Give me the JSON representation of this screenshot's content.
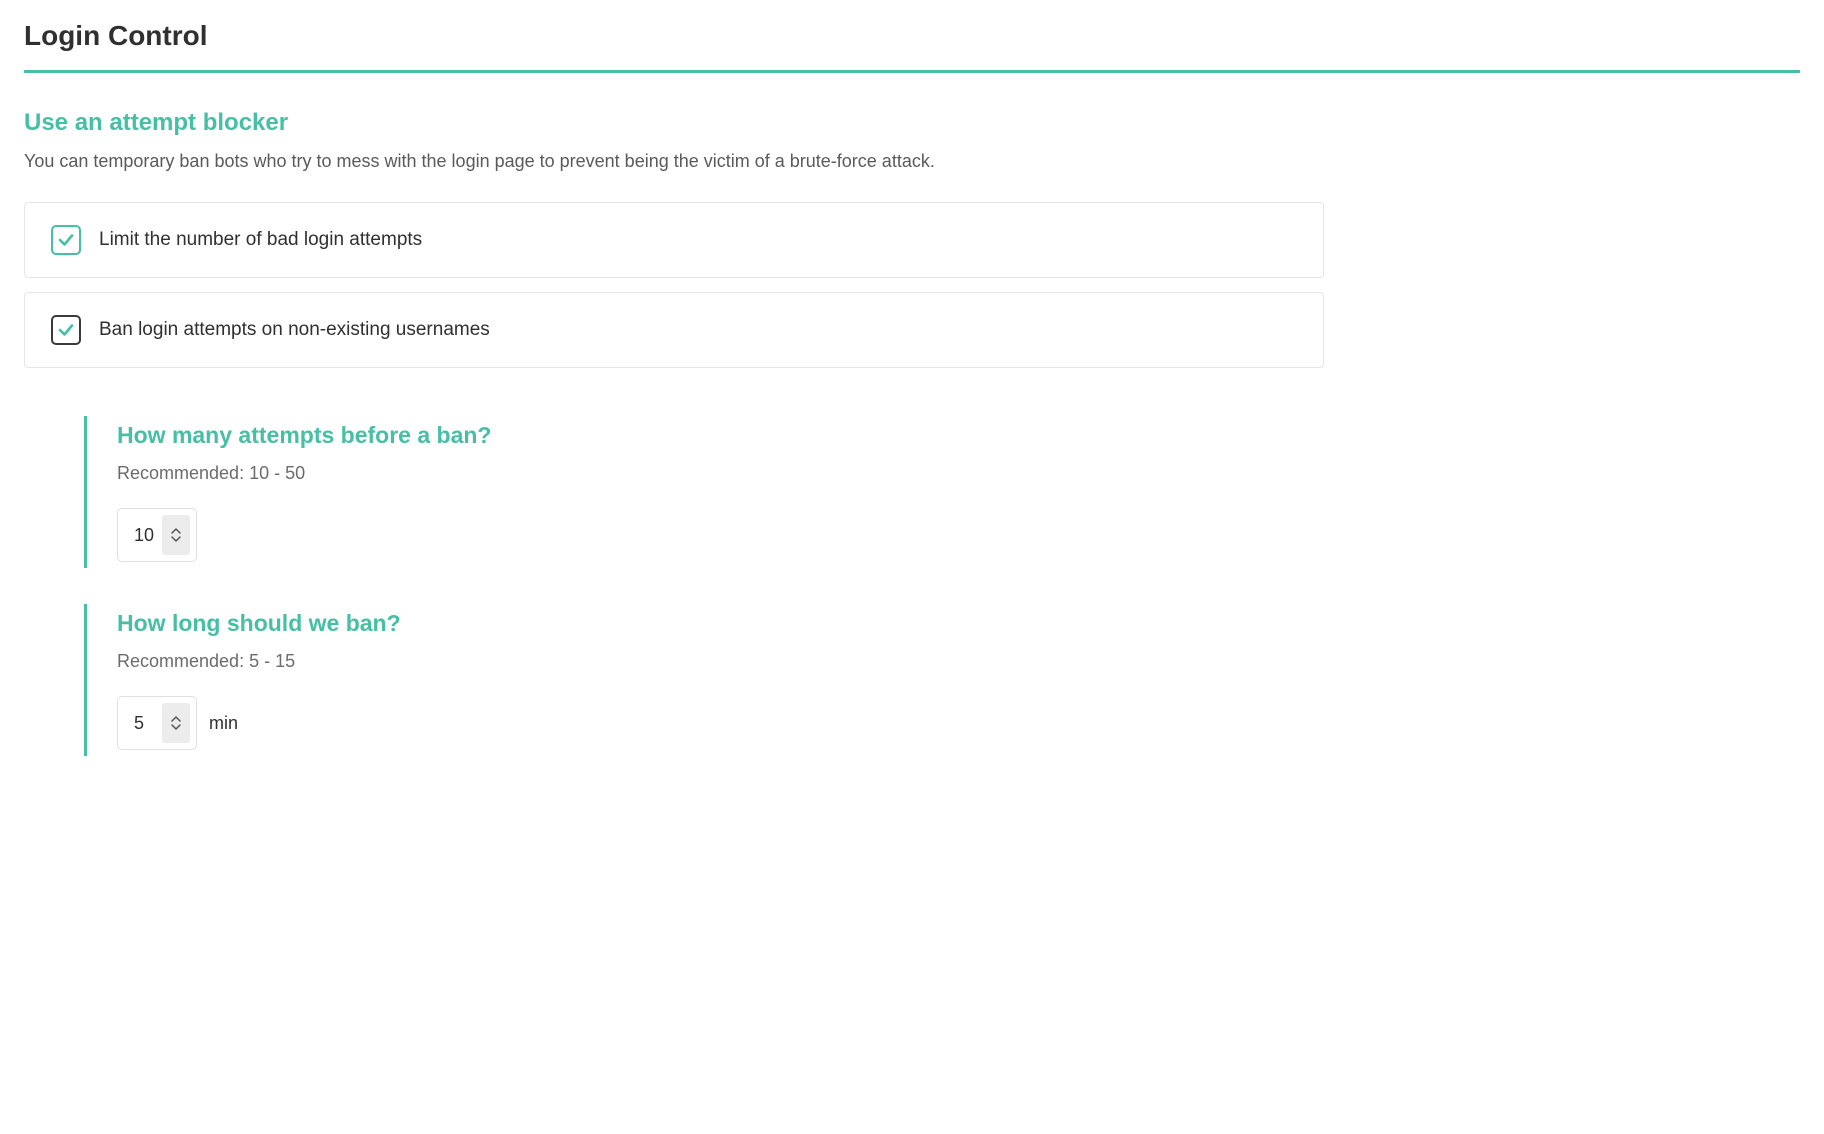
{
  "page": {
    "title": "Login Control"
  },
  "blocker": {
    "title": "Use an attempt blocker",
    "description": "You can temporary ban bots who try to mess with the login page to prevent being the victim of a brute-force attack.",
    "options": {
      "limit_bad": {
        "label": "Limit the number of bad login attempts",
        "checked": true
      },
      "ban_nonexistent": {
        "label": "Ban login attempts on non-existing usernames",
        "checked": true
      }
    }
  },
  "attempts": {
    "title": "How many attempts before a ban?",
    "hint": "Recommended: 10 - 50",
    "value": "10"
  },
  "duration": {
    "title": "How long should we ban?",
    "hint": "Recommended: 5 - 15",
    "value": "5",
    "unit": "min"
  },
  "colors": {
    "accent": "#46bfa5"
  }
}
